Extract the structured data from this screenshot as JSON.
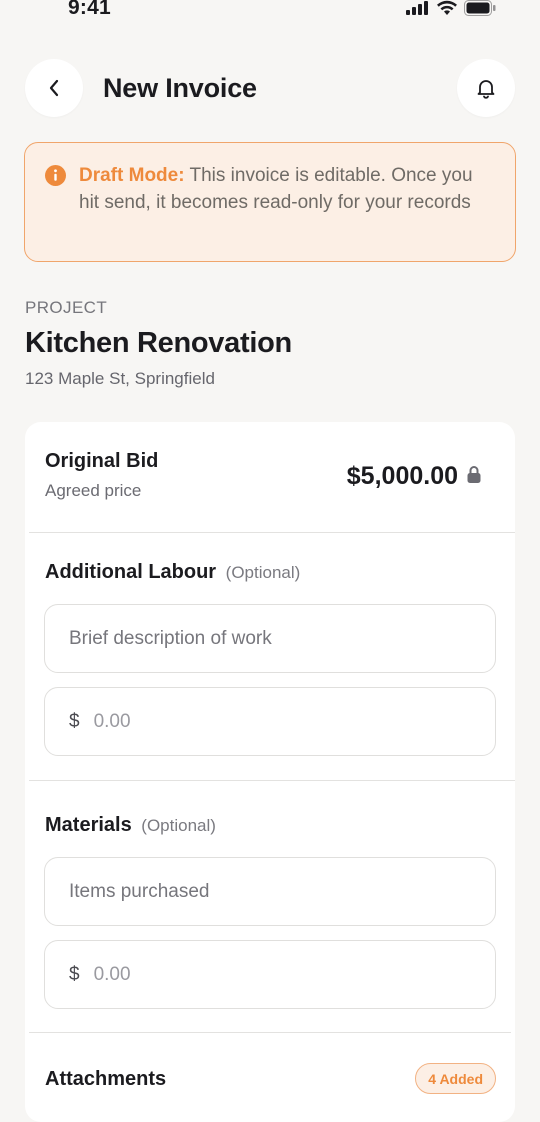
{
  "status_bar": {
    "time": "9:41"
  },
  "header": {
    "title": "New Invoice"
  },
  "banner": {
    "title": "Draft Mode:",
    "message": "This invoice is editable. Once you hit send, it becomes read-only for your records"
  },
  "project": {
    "kicker": "PROJECT",
    "name": "Kitchen Renovation",
    "address": "123 Maple St, Springfield"
  },
  "original_bid": {
    "label": "Original Bid",
    "sub": "Agreed price",
    "amount": "$5,000.00"
  },
  "labour": {
    "title": "Additional Labour",
    "optional": "(Optional)",
    "description_placeholder": "Brief description of work",
    "currency": "$",
    "amount_placeholder": "0.00"
  },
  "materials": {
    "title": "Materials",
    "optional": "(Optional)",
    "items_placeholder": "Items purchased",
    "currency": "$",
    "amount_placeholder": "0.00"
  },
  "attachments": {
    "title": "Attachments",
    "badge": "4 Added"
  },
  "colors": {
    "accent": "#ee8a3c",
    "background": "#f7f6f4",
    "card": "#ffffff",
    "banner_bg": "#fcefe5"
  }
}
